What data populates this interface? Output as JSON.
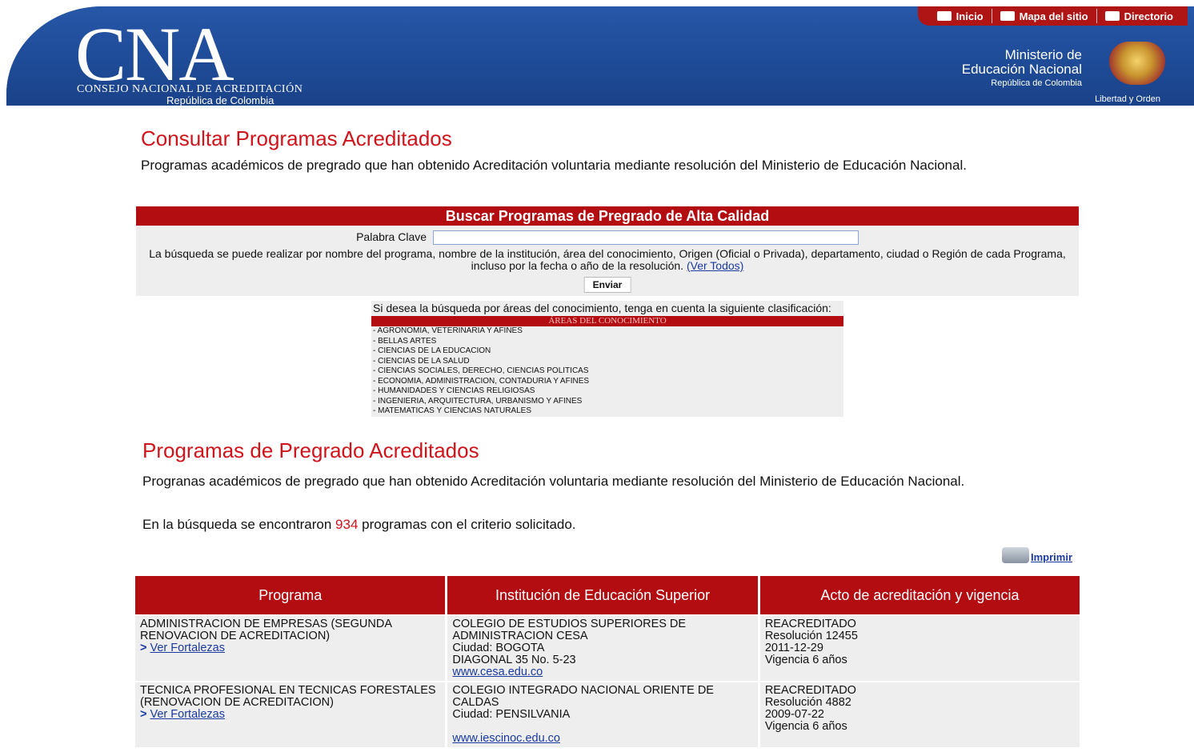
{
  "header": {
    "logo_text": "CNA",
    "logo_subtitle": "CONSEJO NACIONAL DE ACREDITACIÓN",
    "logo_country": "República de Colombia",
    "nav": [
      {
        "label": "Inicio",
        "icon": "home-icon"
      },
      {
        "label": "Mapa del sitio",
        "icon": "sitemap-icon"
      },
      {
        "label": "Directorio",
        "icon": "directory-icon"
      }
    ],
    "ministry_line1": "Ministerio de",
    "ministry_line2": "Educación Nacional",
    "ministry_line3": "República de Colombia",
    "shield_caption": "Libertad y Orden",
    "colors": {
      "banner": "#1f4e9c",
      "accent": "#b30d12"
    }
  },
  "section1": {
    "title": "Consultar Programas Acreditados",
    "description": "Programas académicos de pregrado que han obtenido Acreditación voluntaria mediante resolución del Ministerio de Educación Nacional."
  },
  "search": {
    "heading": "Buscar Programas de Pregrado de Alta Calidad",
    "keyword_label": "Palabra Clave",
    "keyword_value": "",
    "hint": "La búsqueda se puede realizar por nombre del programa, nombre de la institución, área del conocimiento, Origen (Oficial o Privada), departamento, ciudad o Región de cada Programa, incluso por la fecha o año de la resolución.",
    "see_all": "(Ver Todos)",
    "submit": "Enviar"
  },
  "areas": {
    "intro": "Si desea la búsqueda por áreas del conocimiento, tenga en cuenta la siguiente clasificación:",
    "title": "ÁREAS DEL CONOCIMIENTO",
    "items": [
      "- AGRONOMIA, VETERINARIA Y AFINES",
      "- BELLAS ARTES",
      "- CIENCIAS DE LA EDUCACION",
      "- CIENCIAS DE LA SALUD",
      "- CIENCIAS SOCIALES, DERECHO, CIENCIAS POLITICAS",
      "- ECONOMIA, ADMINISTRACION, CONTADURIA Y AFINES",
      "- HUMANIDADES Y CIENCIAS RELIGIOSAS",
      "- INGENIERIA, ARQUITECTURA, URBANISMO Y AFINES",
      "- MATEMATICAS Y CIENCIAS NATURALES"
    ]
  },
  "section2": {
    "title": "Programas de Pregrado Acreditados",
    "description": "Progranas académicos de pregrado que han obtenido Acreditación voluntaria mediante resolución del Ministerio de Educación Nacional.",
    "count_prefix": "En la búsqueda se encontraron",
    "count": "934",
    "count_suffix": "programas con el criterio solicitado.",
    "print_label": "Imprimir"
  },
  "table": {
    "headers": [
      "Programa",
      "Institución de Educación Superior",
      "Acto de acreditación y vigencia"
    ],
    "rows": [
      {
        "program": "ADMINISTRACION DE EMPRESAS (SEGUNDA RENOVACION DE ACREDITACION)",
        "link": "Ver Fortalezas",
        "inst": "COLEGIO DE ESTUDIOS SUPERIORES DE ADMINISTRACION CESA",
        "city": "Ciudad: BOGOTA",
        "address": "DIAGONAL 35 No. 5-23",
        "url": "www.cesa.edu.co",
        "status": "REACREDITADO",
        "resolution": "Resolución 12455",
        "date": "2011-12-29",
        "validity": "Vigencia 6 años"
      },
      {
        "program": "TECNICA PROFESIONAL EN TECNICAS FORESTALES (RENOVACION DE ACREDITACION)",
        "link": "Ver Fortalezas",
        "inst": "COLEGIO INTEGRADO NACIONAL ORIENTE DE CALDAS",
        "city": "Ciudad: PENSILVANIA",
        "address": "",
        "url": "www.iescinoc.edu.co",
        "status": "REACREDITADO",
        "resolution": "Resolución 4882",
        "date": "2009-07-22",
        "validity": "Vigencia 6 años"
      }
    ]
  }
}
